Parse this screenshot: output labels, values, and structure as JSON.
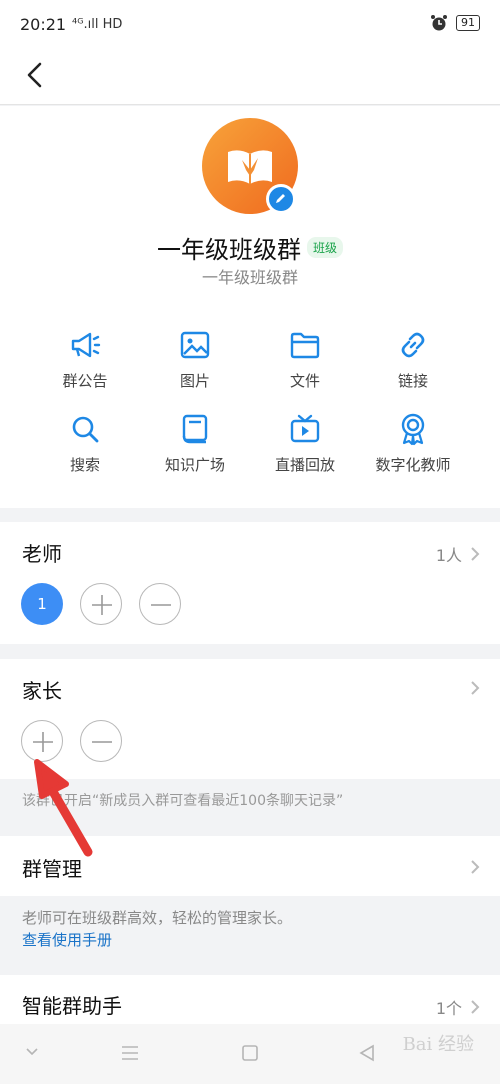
{
  "status": {
    "time": "20:21",
    "network": "⁴ᴳ.ıll HD",
    "battery": "91"
  },
  "group": {
    "name": "一年级班级群",
    "tag": "班级",
    "subtitle": "一年级班级群"
  },
  "features": [
    {
      "label": "群公告",
      "icon": "megaphone-icon"
    },
    {
      "label": "图片",
      "icon": "image-icon"
    },
    {
      "label": "文件",
      "icon": "folder-icon"
    },
    {
      "label": "链接",
      "icon": "link-icon"
    },
    {
      "label": "搜索",
      "icon": "search-icon"
    },
    {
      "label": "知识广场",
      "icon": "book-icon"
    },
    {
      "label": "直播回放",
      "icon": "tv-icon"
    },
    {
      "label": "数字化教师",
      "icon": "badge-icon"
    }
  ],
  "teachers": {
    "title": "老师",
    "count": "1人",
    "member_initial": "1"
  },
  "parents": {
    "title": "家长"
  },
  "notice": "该群已开启“新成员入群可查看最近100条聊天记录”",
  "management": {
    "title": "群管理",
    "hint": "老师可在班级群高效，轻松的管理家长。",
    "link": "查看使用手册"
  },
  "assistant": {
    "title": "智能群助手",
    "count": "1个"
  },
  "watermark": "Bai 经验",
  "colors": {
    "accent": "#1e88e5",
    "tag_green": "#1aa34a",
    "arrow_red": "#e53935",
    "avatar_orange": "#f28a2b"
  }
}
